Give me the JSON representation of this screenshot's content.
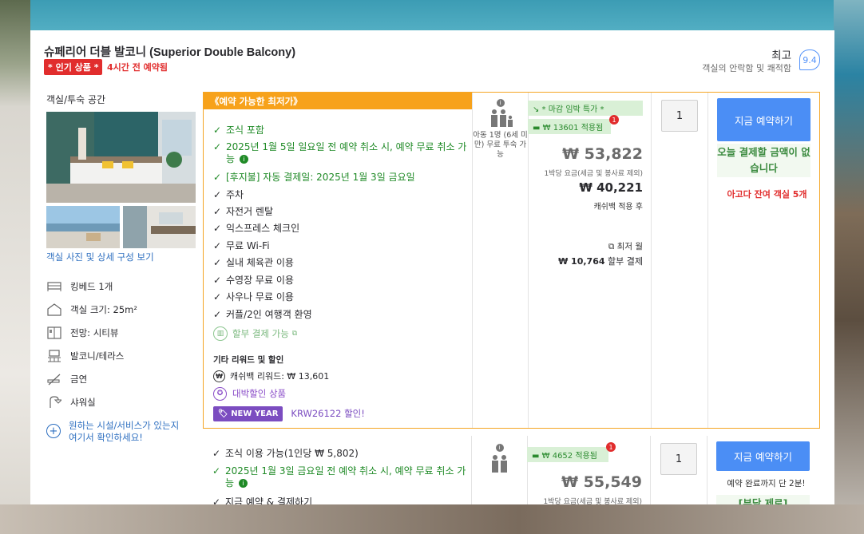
{
  "room": {
    "title": "슈페리어 더블 발코니 (Superior Double Balcony)",
    "popular_badge": "* 인기 상품 *",
    "recent_booking": "4시간 전 예약됨",
    "rating_word": "최고",
    "rating_sub": "객실의 안락함 및 쾌적함",
    "rating_score": "9.4",
    "room_type": "객실/투숙 공간",
    "photos_link": "객실 사진 및 상세 구성 보기",
    "features": [
      {
        "icon": "bed-icon",
        "label": "킹베드 1개"
      },
      {
        "icon": "room-size-icon",
        "label": "객실 크기: 25m²"
      },
      {
        "icon": "view-icon",
        "label": "전망: 시티뷰"
      },
      {
        "icon": "balcony-icon",
        "label": "발코니/테라스"
      },
      {
        "icon": "no-smoking-icon",
        "label": "금연"
      },
      {
        "icon": "shower-icon",
        "label": "샤워실"
      }
    ],
    "more_facilities": "원하는 시설/서비스가 있는지 여기서 확인하세요!"
  },
  "offer1": {
    "header": "《예약 가능한 최저가》",
    "benefits": [
      {
        "text": "조식 포함",
        "color": "green"
      },
      {
        "text": "2025년 1월 5일 일요일 전 예약 취소 시, 예약 무료 취소 가능",
        "color": "green",
        "info": true
      },
      {
        "text": "[후지불] 자동 결제일: 2025년 1월 3일 금요일",
        "color": "green"
      },
      {
        "text": "주차",
        "color": "black"
      },
      {
        "text": "자전거 렌탈",
        "color": "black"
      },
      {
        "text": "익스프레스 체크인",
        "color": "black"
      },
      {
        "text": "무료 Wi-Fi",
        "color": "black"
      },
      {
        "text": "실내 체육관 이용",
        "color": "black"
      },
      {
        "text": "수영장 무료 이용",
        "color": "black"
      },
      {
        "text": "사우나 무료 이용",
        "color": "black"
      },
      {
        "text": "커플/2인 여행객 환영",
        "color": "black"
      }
    ],
    "installment": "할부 결제 가능",
    "other_rewards_title": "기타 리워드 및 할인",
    "cashback": "캐쉬백 리워드: ₩ 13,601",
    "jackpot": "대박할인 상품",
    "promo_badge": "NEW YEAR",
    "promo_code": "KRW26122 할인!",
    "occupancy_child": "아동 1명 (6세 미만) 무료 투숙 가능",
    "occupancy_child_free": "무료",
    "deal_tag": "↘ * 마감 임박 특가 *",
    "coupon_tag": "₩ 13601 적용됨",
    "coupon_count": "1",
    "price": "₩ 53,822",
    "price_note": "1박당 요금(세금 및 봉사료 제외)",
    "cashback_price": "₩ 40,221",
    "cashback_note": "캐쉬백 적용 후",
    "monthly_label": "최저 월",
    "monthly_amount": "₩ 10,764",
    "monthly_suffix": "할부 결제",
    "qty": "1",
    "book_button": "지금 예약하기",
    "pay_today": "오늘 결제할 금액이 없습니다",
    "rooms_left": "아고다 잔여 객실 5개"
  },
  "offer2": {
    "benefits": [
      {
        "text": "조식 이용 가능(1인당 ₩ 5,802)",
        "color": "black"
      },
      {
        "text": "2025년 1월 3일 금요일 전 예약 취소 시, 예약 무료 취소 가능",
        "color": "green",
        "info": true
      },
      {
        "text": "지금 예약 & 결제하기",
        "color": "black"
      }
    ],
    "coupon_tag": "₩ 4652 적용됨",
    "coupon_count": "1",
    "price": "₩ 55,549",
    "price_note": "1박당 요금(세금 및 봉사료 제외)",
    "qty": "1",
    "book_button": "지금 예약하기",
    "note": "예약 완료까지 단 2분!",
    "bottom_tag": "[부담 제로]"
  }
}
